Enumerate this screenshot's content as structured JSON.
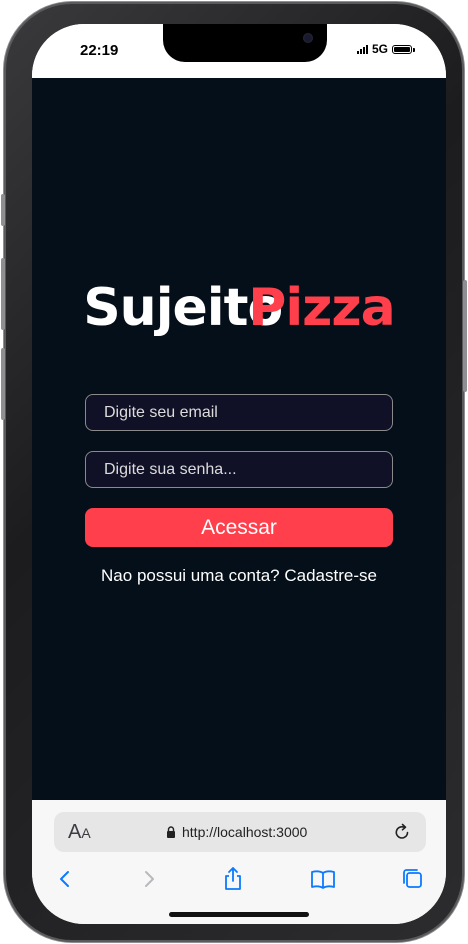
{
  "status_bar": {
    "time": "22:19",
    "network": "5G"
  },
  "app": {
    "logo": {
      "part1": "Sujeito",
      "part2": "Pizza"
    },
    "email_input": {
      "placeholder": "Digite seu email",
      "value": ""
    },
    "password_input": {
      "placeholder": "Digite sua senha...",
      "value": ""
    },
    "login_button_label": "Acessar",
    "signup_link_label": "Nao possui uma conta? Cadastre-se"
  },
  "browser": {
    "text_size_button": "AA",
    "url": "http://localhost:3000",
    "icons": [
      "lock-icon",
      "reload-icon",
      "back-icon",
      "forward-icon",
      "share-icon",
      "bookmarks-icon",
      "tabs-icon"
    ]
  },
  "colors": {
    "background": "#050f19",
    "accent": "#ff3f4b",
    "input_background": "#101026",
    "input_border": "#8a8a8a",
    "browser_blue": "#0a7aff"
  }
}
